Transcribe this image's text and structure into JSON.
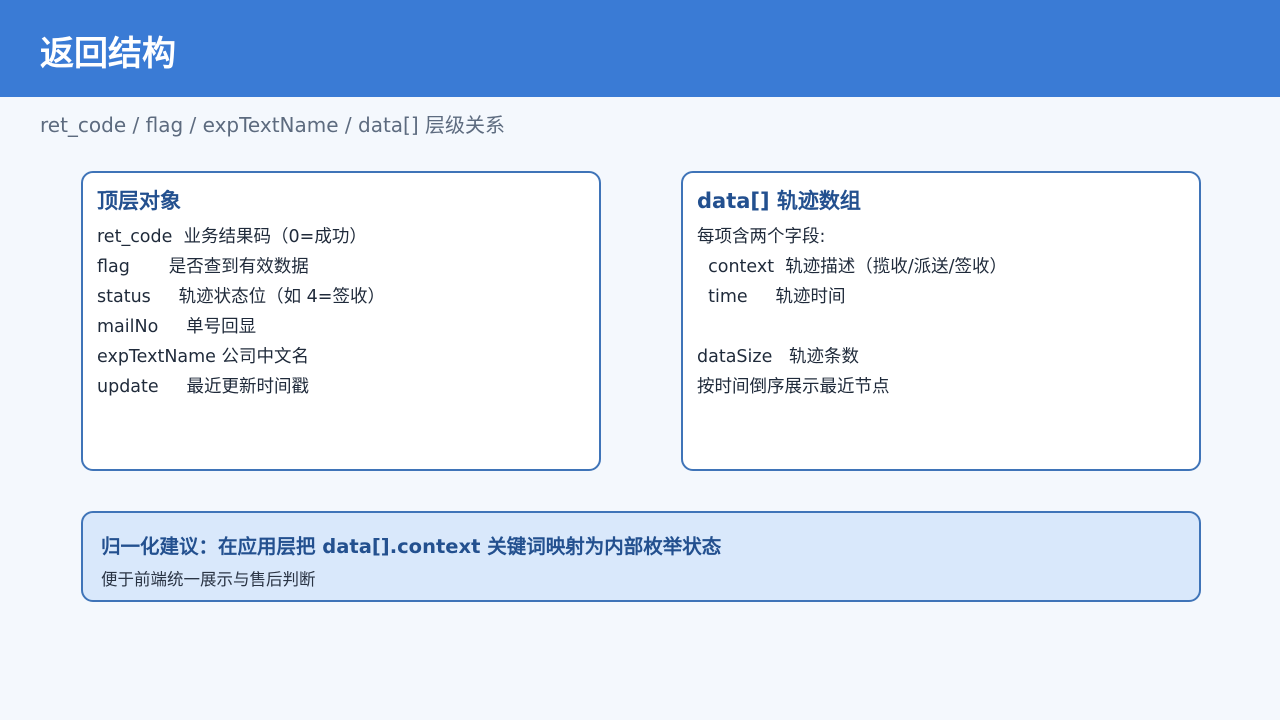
{
  "header": {
    "title": "返回结构"
  },
  "subtitle": "ret_code / flag / expTextName / data[] 层级关系",
  "cards": [
    {
      "title": "顶层对象",
      "lines": [
        "ret_code  业务结果码（0=成功）",
        "flag       是否查到有效数据",
        "status     轨迹状态位（如 4=签收）",
        "mailNo     单号回显",
        "expTextName 公司中文名",
        "update     最近更新时间戳"
      ]
    },
    {
      "title": "data[] 轨迹数组",
      "lines": [
        "每项含两个字段:",
        "  context  轨迹描述（揽收/派送/签收）",
        "  time     轨迹时间",
        "",
        "dataSize   轨迹条数",
        "按时间倒序展示最近节点"
      ]
    }
  ],
  "callout": {
    "title": "归一化建议：在应用层把 data[].context 关键词映射为内部枚举状态",
    "subtitle": "便于前端统一展示与售后判断"
  },
  "colors": {
    "header_bg": "#3a7bd5",
    "accent": "#3f74b8",
    "title_text": "#23508f",
    "callout_bg": "#d9e8fb"
  }
}
